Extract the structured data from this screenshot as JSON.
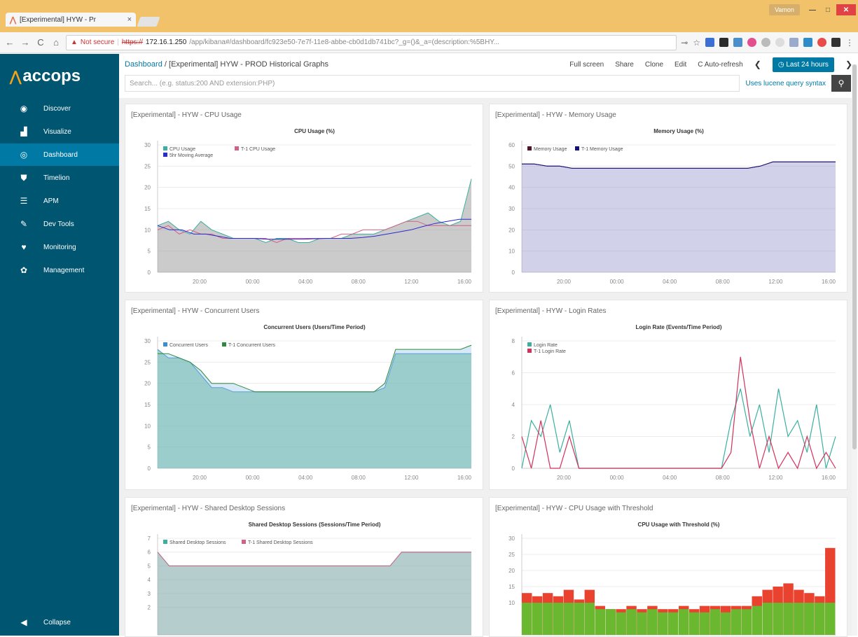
{
  "browser": {
    "tab_title": "[Experimental] HYW - Pr",
    "tab_close": "×",
    "window_user": "Vamon",
    "url_warning": "Not secure",
    "url_scheme": "https://",
    "url_host": "172.16.1.250",
    "url_path": "/app/kibana#/dashboard/fc923e50-7e7f-11e8-abbe-cb0d1db741bc?_g=()&_a=(description:%5BHY..."
  },
  "sidebar": {
    "brand": "accops",
    "items": [
      {
        "label": "Discover",
        "icon": "compass-icon"
      },
      {
        "label": "Visualize",
        "icon": "bar-chart-icon"
      },
      {
        "label": "Dashboard",
        "icon": "dashboard-icon"
      },
      {
        "label": "Timelion",
        "icon": "shield-icon"
      },
      {
        "label": "APM",
        "icon": "apm-icon"
      },
      {
        "label": "Dev Tools",
        "icon": "wrench-icon"
      },
      {
        "label": "Monitoring",
        "icon": "heartbeat-icon"
      },
      {
        "label": "Management",
        "icon": "gear-icon"
      }
    ],
    "active": "Dashboard",
    "collapse": "Collapse"
  },
  "topbar": {
    "breadcrumb_root": "Dashboard",
    "breadcrumb_sep": "/",
    "breadcrumb_current": "[Experimental] HYW - PROD Historical Graphs",
    "menu": [
      "Full screen",
      "Share",
      "Clone",
      "Edit",
      "Auto-refresh"
    ],
    "time_range": "Last 24 hours",
    "search_placeholder": "Search... (e.g. status:200 AND extension:PHP)",
    "lucene": "Uses lucene query syntax"
  },
  "panels": [
    {
      "title": "[Experimental] - HYW - CPU Usage"
    },
    {
      "title": "[Experimental] - HYW - Memory Usage"
    },
    {
      "title": "[Experimental] - HYW - Concurrent Users"
    },
    {
      "title": "[Experimental] - HYW - Login Rates"
    },
    {
      "title": "[Experimental] - HYW - Shared Desktop Sessions"
    },
    {
      "title": "[Experimental] - HYW - CPU Usage with Threshold"
    }
  ],
  "chart_data": [
    {
      "type": "area",
      "title": "CPU Usage (%)",
      "x_ticks": [
        "20:00",
        "00:00",
        "04:00",
        "08:00",
        "12:00",
        "16:00"
      ],
      "ylim": [
        0,
        30
      ],
      "y_ticks": [
        0,
        5,
        10,
        15,
        20,
        25,
        30
      ],
      "legend": "top-left",
      "series": [
        {
          "name": "CPU Usage",
          "color": "#3ab0a0",
          "values": [
            11,
            12,
            10,
            9,
            12,
            10,
            9,
            8,
            8,
            8,
            7,
            8,
            8,
            7,
            7,
            8,
            8,
            8,
            9,
            9,
            9,
            10,
            11,
            12,
            13,
            14,
            12,
            11,
            12,
            22
          ]
        },
        {
          "name": "T-1 CPU Usage",
          "color": "#d36086",
          "values": [
            10,
            11,
            9,
            10,
            9,
            9,
            8,
            8,
            8,
            8,
            8,
            7,
            8,
            8,
            8,
            8,
            8,
            9,
            9,
            10,
            10,
            10,
            11,
            12,
            12,
            11,
            11,
            11,
            11,
            11
          ]
        },
        {
          "name": "5hr Moving Average",
          "color": "#2b2bd0",
          "values": [
            11,
            10,
            10,
            9,
            9,
            8.5,
            8,
            8,
            8,
            7.8,
            7.8,
            7.8,
            7.8,
            7.9,
            8,
            8,
            8,
            8.2,
            8.5,
            9,
            9.5,
            10,
            10.8,
            11.5,
            12,
            12.5,
            12.5
          ]
        }
      ]
    },
    {
      "type": "area",
      "title": "Memory Usage (%)",
      "x_ticks": [
        "20:00",
        "00:00",
        "04:00",
        "08:00",
        "12:00",
        "16:00"
      ],
      "ylim": [
        0,
        60
      ],
      "y_ticks": [
        0,
        10,
        20,
        30,
        40,
        50,
        60
      ],
      "legend": "top-left",
      "series": [
        {
          "name": "Memory Usage",
          "color": "#57102a",
          "values": [
            51,
            51,
            50,
            50,
            49,
            49,
            49,
            49,
            49,
            49,
            49,
            49,
            49,
            49,
            49,
            49,
            49,
            49,
            49,
            50,
            52,
            52,
            52,
            52,
            52,
            52
          ]
        },
        {
          "name": "T-1 Memory Usage",
          "color": "#12127a",
          "values": [
            51,
            51,
            50,
            50,
            49,
            49,
            49,
            49,
            49,
            49,
            49,
            49,
            49,
            49,
            49,
            49,
            49,
            49,
            49,
            50,
            52,
            52,
            52,
            52,
            52,
            52
          ]
        }
      ]
    },
    {
      "type": "area",
      "title": "Concurrent Users (Users/Time Period)",
      "x_ticks": [
        "20:00",
        "00:00",
        "04:00",
        "08:00",
        "12:00",
        "16:00"
      ],
      "ylim": [
        0,
        30
      ],
      "y_ticks": [
        0,
        5,
        10,
        15,
        20,
        25,
        30
      ],
      "legend": "top-left",
      "series": [
        {
          "name": "Concurrent Users",
          "color": "#3a8fd0",
          "values": [
            28,
            26,
            26,
            25,
            22,
            19,
            19,
            18,
            18,
            18,
            18,
            18,
            18,
            18,
            18,
            18,
            18,
            18,
            18,
            18,
            18,
            19,
            27,
            27,
            27,
            27,
            27,
            27,
            27,
            27
          ]
        },
        {
          "name": "T-1 Concurrent Users",
          "color": "#2e8b3e",
          "values": [
            27,
            27,
            26,
            25,
            23,
            20,
            20,
            20,
            19,
            18,
            18,
            18,
            18,
            18,
            18,
            18,
            18,
            18,
            18,
            18,
            18,
            20,
            28,
            28,
            28,
            28,
            28,
            28,
            28,
            29
          ]
        }
      ]
    },
    {
      "type": "line",
      "title": "Login Rate (Events/Time Period)",
      "x_ticks": [
        "20:00",
        "00:00",
        "04:00",
        "08:00",
        "12:00",
        "16:00"
      ],
      "ylim": [
        0,
        8
      ],
      "y_ticks": [
        0,
        2,
        4,
        6,
        8
      ],
      "legend": "top-left",
      "series": [
        {
          "name": "Login Rate",
          "color": "#3ab0a0",
          "values": [
            0,
            3,
            2,
            4,
            1,
            3,
            0,
            0,
            0,
            0,
            0,
            0,
            0,
            0,
            0,
            0,
            0,
            0,
            0,
            0,
            0,
            0,
            3,
            5,
            2,
            4,
            1,
            5,
            2,
            3,
            1,
            4,
            0,
            2
          ]
        },
        {
          "name": "T-1 Login Rate",
          "color": "#d3305a",
          "values": [
            2,
            0,
            3,
            0,
            0,
            2,
            0,
            0,
            0,
            0,
            0,
            0,
            0,
            0,
            0,
            0,
            0,
            0,
            0,
            0,
            0,
            0,
            1,
            7,
            3,
            0,
            2,
            0,
            1,
            0,
            2,
            0,
            1,
            0
          ]
        }
      ]
    },
    {
      "type": "area",
      "title": "Shared Desktop Sessions (Sessions/Time Period)",
      "ylim": [
        0,
        7
      ],
      "y_ticks": [
        2,
        3,
        4,
        5,
        6,
        7
      ],
      "legend": "top-left",
      "series": [
        {
          "name": "Shared Desktop Sessions",
          "color": "#3ab0a0",
          "values": [
            6,
            5,
            5,
            5,
            5,
            5,
            5,
            5,
            5,
            5,
            5,
            5,
            5,
            5,
            5,
            5,
            5,
            5,
            5,
            5,
            5,
            6,
            6,
            6,
            6,
            6,
            6,
            6
          ]
        },
        {
          "name": "T-1 Shared Desktop Sessions",
          "color": "#d36086",
          "values": [
            6,
            5,
            5,
            5,
            5,
            5,
            5,
            5,
            5,
            5,
            5,
            5,
            5,
            5,
            5,
            5,
            5,
            5,
            5,
            5,
            5,
            6,
            6,
            6,
            6,
            6,
            6,
            6
          ]
        }
      ]
    },
    {
      "type": "bar",
      "title": "CPU Usage with Threshold (%)",
      "ylim": [
        0,
        30
      ],
      "y_ticks": [
        10,
        15,
        20,
        25,
        30
      ],
      "series": [
        {
          "name": "",
          "color": "#6ab82f",
          "values": [
            10,
            10,
            10,
            10,
            10,
            10,
            10,
            8,
            8,
            7,
            8,
            7,
            8,
            7,
            7,
            8,
            7,
            7,
            8,
            7,
            8,
            8,
            9,
            10,
            10,
            10,
            10,
            10,
            10,
            10
          ]
        },
        {
          "name": "",
          "color": "#e9422f",
          "values": [
            13,
            12,
            13,
            12,
            14,
            11,
            14,
            9,
            8,
            8,
            9,
            8,
            9,
            8,
            8,
            9,
            8,
            9,
            9,
            9,
            9,
            9,
            12,
            14,
            15,
            16,
            14,
            13,
            12,
            27
          ]
        }
      ]
    }
  ]
}
